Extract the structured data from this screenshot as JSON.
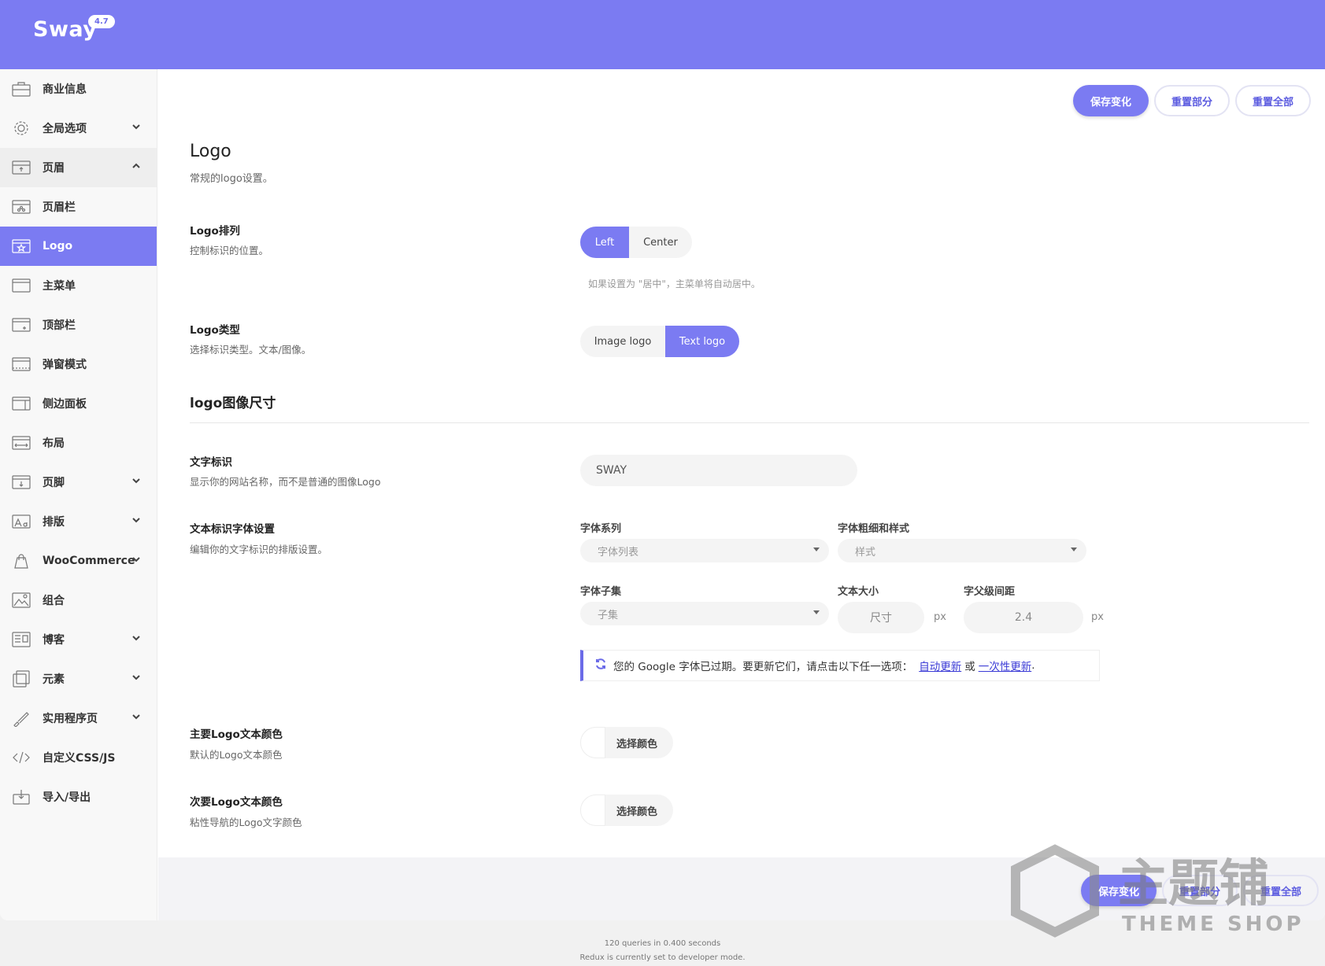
{
  "header": {
    "brand": "Sway",
    "version": "4.7"
  },
  "sidebar": {
    "items": [
      {
        "label": "商业信息",
        "icon": "briefcase-icon",
        "chevron": ""
      },
      {
        "label": "全局选项",
        "icon": "gear-icon",
        "chevron": "down"
      },
      {
        "label": "页眉",
        "icon": "header-icon",
        "chevron": "up",
        "state": "expanded"
      },
      {
        "label": "页眉栏",
        "icon": "header-bar-icon",
        "chevron": ""
      },
      {
        "label": "Logo",
        "icon": "star-window-icon",
        "chevron": "",
        "state": "active"
      },
      {
        "label": "主菜单",
        "icon": "menu-window-icon",
        "chevron": ""
      },
      {
        "label": "顶部栏",
        "icon": "topbar-icon",
        "chevron": ""
      },
      {
        "label": "弹窗模式",
        "icon": "popup-icon",
        "chevron": ""
      },
      {
        "label": "侧边面板",
        "icon": "side-panel-icon",
        "chevron": ""
      },
      {
        "label": "布局",
        "icon": "layout-icon",
        "chevron": ""
      },
      {
        "label": "页脚",
        "icon": "footer-icon",
        "chevron": "down"
      },
      {
        "label": "排版",
        "icon": "typography-icon",
        "chevron": "down"
      },
      {
        "label": "WooCommerce",
        "icon": "shopping-bag-icon",
        "chevron": "down"
      },
      {
        "label": "组合",
        "icon": "image-icon",
        "chevron": ""
      },
      {
        "label": "博客",
        "icon": "blog-icon",
        "chevron": "down"
      },
      {
        "label": "元素",
        "icon": "elements-icon",
        "chevron": "down"
      },
      {
        "label": "实用程序页",
        "icon": "brush-icon",
        "chevron": "down"
      },
      {
        "label": "自定义CSS/JS",
        "icon": "code-icon",
        "chevron": ""
      },
      {
        "label": "导入/导出",
        "icon": "import-export-icon",
        "chevron": ""
      }
    ]
  },
  "toolbar": {
    "save": "保存变化",
    "reset_section": "重置部分",
    "reset_all": "重置全部"
  },
  "section": {
    "title": "Logo",
    "desc": "常规的logo设置。"
  },
  "logo_align": {
    "title": "Logo排列",
    "desc": "控制标识的位置。",
    "options": [
      "Left",
      "Center"
    ],
    "selected": "Left",
    "hint": "如果设置为 \"居中\"，主菜单将自动居中。"
  },
  "logo_type": {
    "title": "Logo类型",
    "desc": "选择标识类型。文本/图像。",
    "options": [
      "Image logo",
      "Text logo"
    ],
    "selected": "Text logo"
  },
  "subhead": "logo图像尺寸",
  "text_logo": {
    "title": "文字标识",
    "desc": "显示你的网站名称，而不是普通的图像Logo",
    "value": "SWAY"
  },
  "font": {
    "title": "文本标识字体设置",
    "desc": "编辑你的文字标识的排版设置。",
    "family_label": "字体系列",
    "family_placeholder": "字体列表",
    "weight_label": "字体粗细和样式",
    "weight_placeholder": "样式",
    "subset_label": "字体子集",
    "subset_placeholder": "子集",
    "size_label": "文本大小",
    "size_placeholder": "尺寸",
    "size_unit": "px",
    "spacing_label": "字父级间距",
    "spacing_value": "2.4",
    "spacing_unit": "px",
    "notice_text": "您的 Google 字体已过期。要更新它们，请点击以下任一选项：",
    "notice_link1": "自动更新",
    "notice_or": "或",
    "notice_link2": "一次性更新",
    "notice_end": "."
  },
  "primary_color": {
    "title": "主要Logo文本颜色",
    "desc": "默认的Logo文本颜色",
    "button": "选择颜色"
  },
  "secondary_color": {
    "title": "次要Logo文本颜色",
    "desc": "粘性导航的Logo文字颜色",
    "button": "选择颜色"
  },
  "footer_info": {
    "queries": "120 queries in 0.400 seconds",
    "mode": "Redux is currently set to developer mode."
  },
  "watermark": {
    "text": "主题铺",
    "sub": "THEME SHOP"
  },
  "colors": {
    "accent": "#7b7bf2",
    "link": "#3b3bd6"
  }
}
